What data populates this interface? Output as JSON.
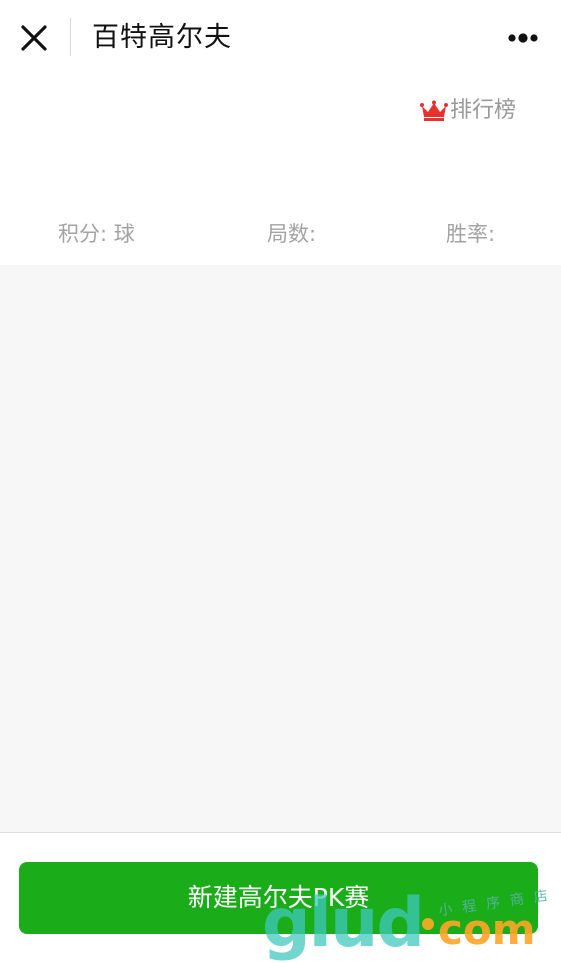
{
  "navbar": {
    "title": "百特高尔夫",
    "close_icon": "close-icon",
    "more_icon": "more-dots-icon"
  },
  "ranking": {
    "icon": "crown-icon",
    "icon_color": "#e8312f",
    "label": "排行榜"
  },
  "stats": {
    "score_label": "积分: 球",
    "rounds_label": "局数:",
    "winrate_label": "胜率:"
  },
  "actions": {
    "new_pk_label": "新建高尔夫PK赛",
    "button_color": "#1aad19"
  },
  "watermark": {
    "brand": "glud",
    "domain": "com",
    "tagline": "小程序商店"
  }
}
